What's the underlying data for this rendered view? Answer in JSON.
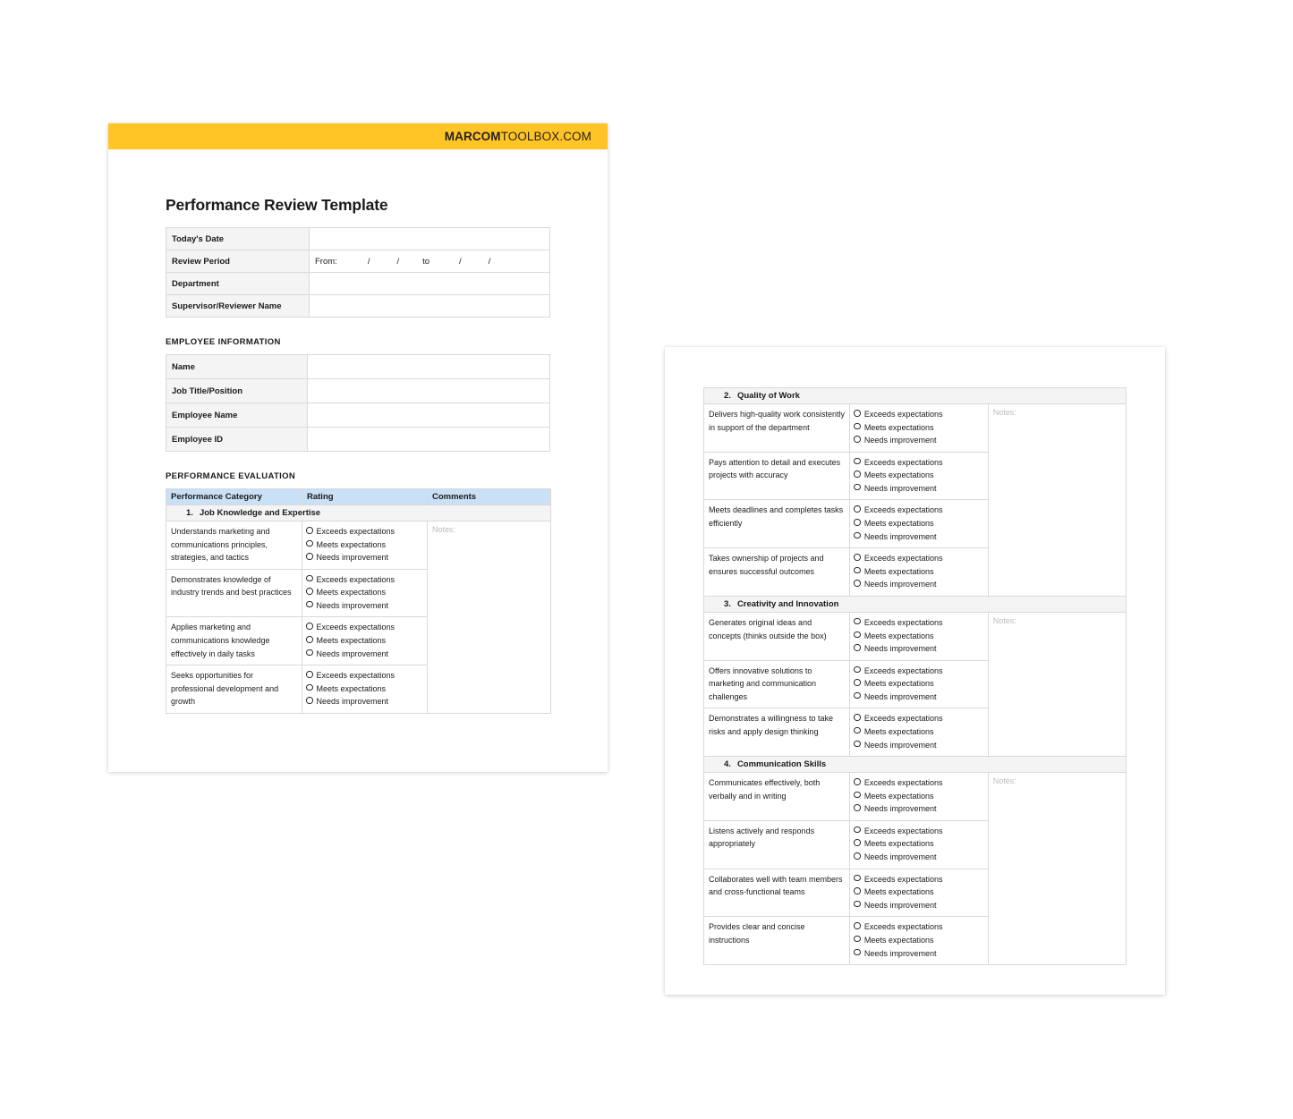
{
  "brand": {
    "bold_part": "MARCOM",
    "light_part": "TOOLBOX.COM"
  },
  "document": {
    "title": "Performance Review Template"
  },
  "header_info": {
    "rows": [
      {
        "label": "Today's Date",
        "value": ""
      },
      {
        "label": "Review Period",
        "value": ""
      },
      {
        "label": "Department",
        "value": ""
      },
      {
        "label": "Supervisor/Reviewer Name",
        "value": ""
      }
    ],
    "review_period": {
      "from_label": "From:",
      "slash_1": "/",
      "slash_2": "/",
      "to_label": "to",
      "slash_3": "/",
      "slash_4": "/"
    }
  },
  "employee_information": {
    "heading": "EMPLOYEE INFORMATION",
    "rows": [
      {
        "label": "Name",
        "value": ""
      },
      {
        "label": "Job Title/Position",
        "value": ""
      },
      {
        "label": "Employee Name",
        "value": ""
      },
      {
        "label": "Employee ID",
        "value": ""
      }
    ]
  },
  "performance_evaluation": {
    "heading": "PERFORMANCE EVALUATION",
    "columns": {
      "category": "Performance Category",
      "rating": "Rating",
      "comments": "Comments"
    },
    "notes_label": "Notes:",
    "rating_options": [
      "Exceeds expectations",
      "Meets expectations",
      "Needs improvement"
    ],
    "sections": [
      {
        "number": "1.",
        "title": "Job Knowledge and Expertise",
        "criteria": [
          "Understands marketing and communications principles, strategies, and tactics",
          "Demonstrates knowledge of industry trends and best practices",
          "Applies marketing and communications knowledge effectively in daily tasks",
          "Seeks opportunities for professional development and growth"
        ]
      },
      {
        "number": "2.",
        "title": "Quality of Work",
        "criteria": [
          "Delivers high-quality work consistently in support of the department",
          "Pays attention to detail and executes projects with accuracy",
          "Meets deadlines and completes tasks efficiently",
          "Takes ownership of projects and ensures successful outcomes"
        ]
      },
      {
        "number": "3.",
        "title": "Creativity and Innovation",
        "criteria": [
          "Generates original ideas and concepts (thinks outside the box)",
          "Offers innovative solutions to marketing and communication challenges",
          "Demonstrates a willingness to take risks and apply design thinking"
        ]
      },
      {
        "number": "4.",
        "title": "Communication Skills",
        "criteria": [
          "Communicates effectively, both verbally and in writing",
          "Listens actively and responds appropriately",
          "Collaborates well with team members and cross-functional teams",
          "Provides clear and concise instructions"
        ]
      }
    ]
  },
  "colors": {
    "brand_yellow": "#FFC425",
    "table_header_blue": "#C9E0F7",
    "section_gray": "#F4F4F4",
    "border_gray": "#D9D9D9",
    "notes_gray": "#BCBCBC"
  }
}
